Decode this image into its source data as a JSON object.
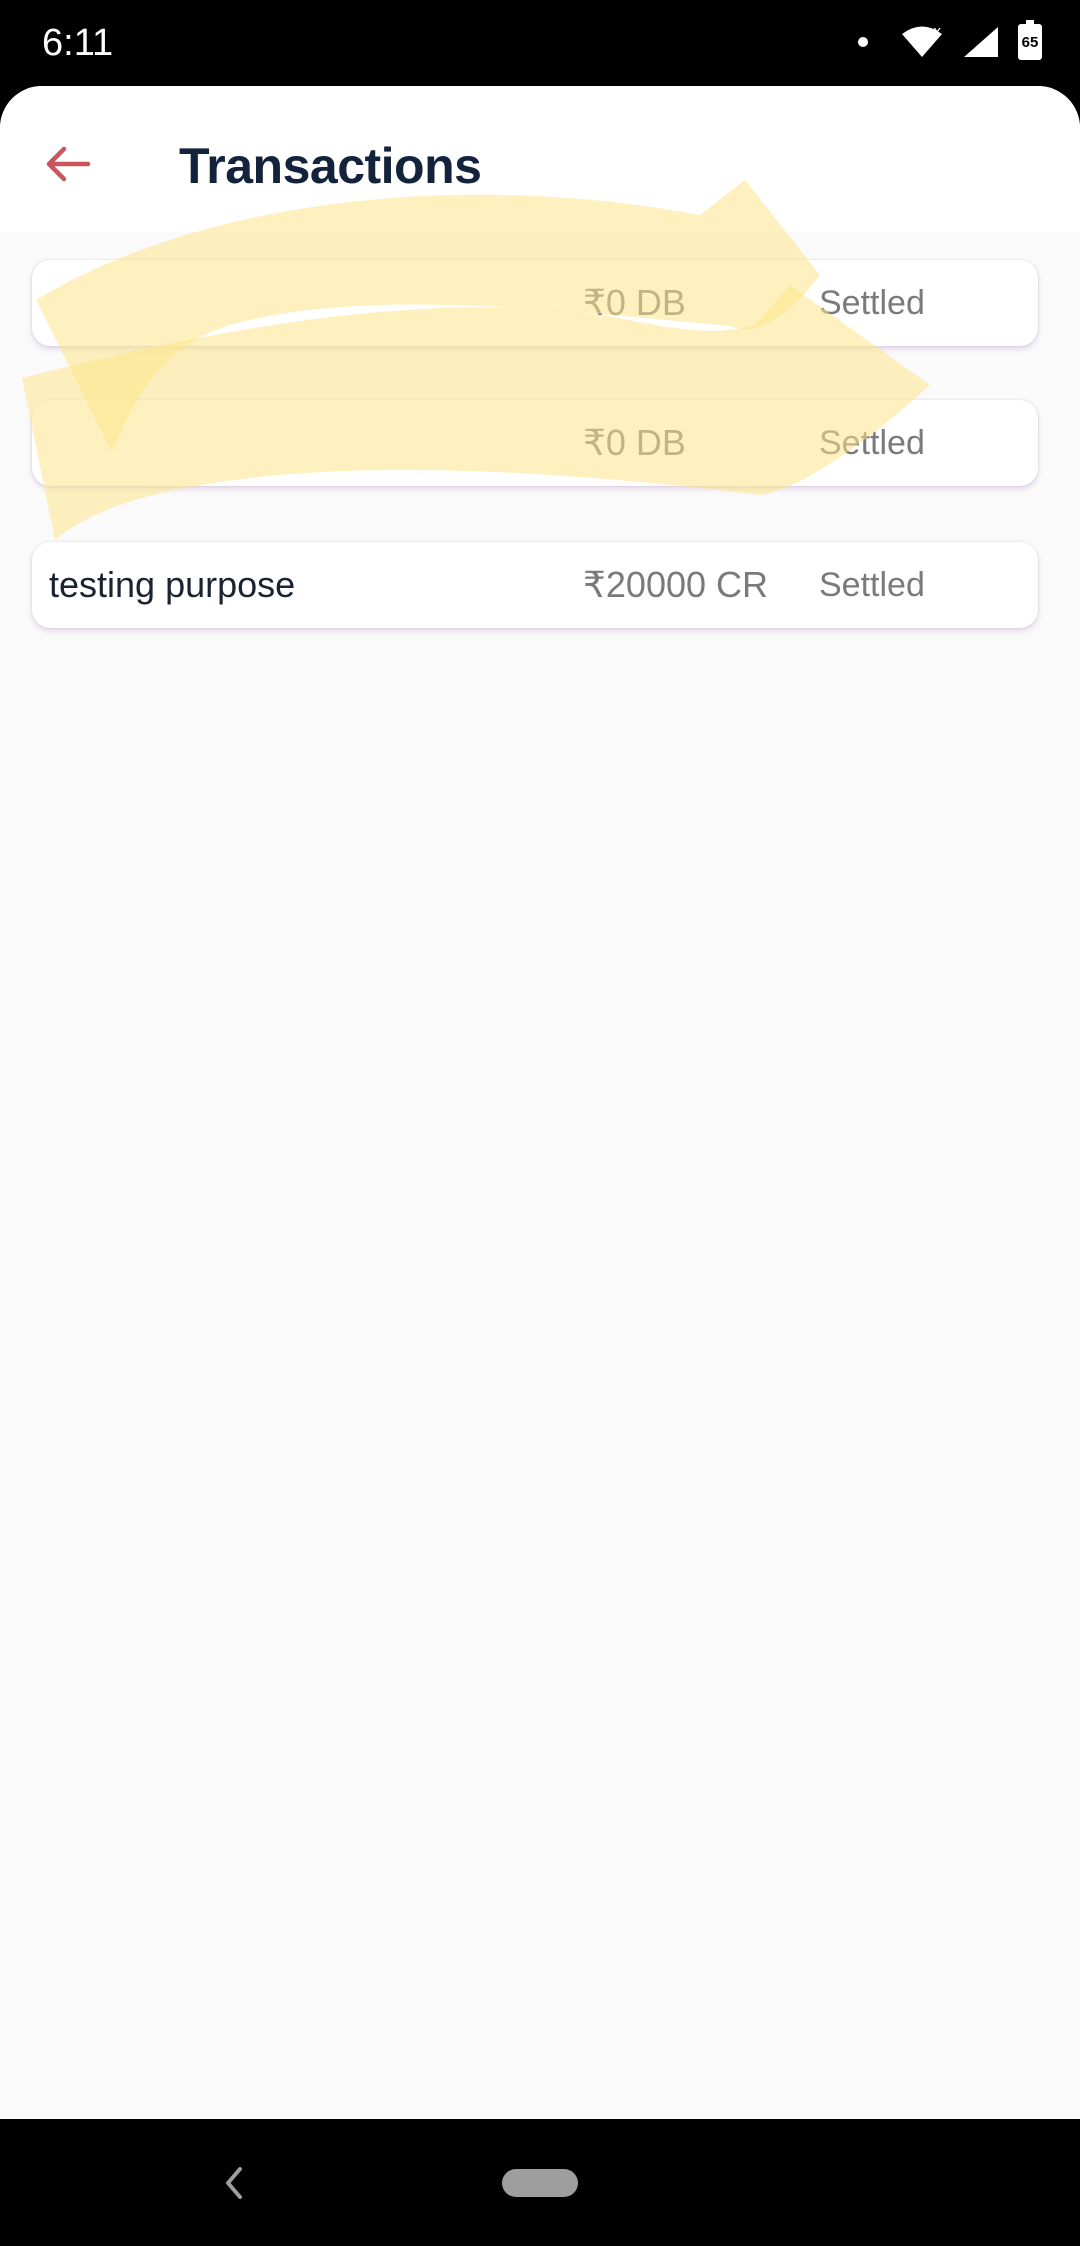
{
  "status_bar": {
    "time": "6:11",
    "battery_level": "65"
  },
  "header": {
    "title": "Transactions"
  },
  "transactions": [
    {
      "description": "",
      "amount": "₹0 DB",
      "status": "Settled"
    },
    {
      "description": "",
      "amount": "₹0 DB",
      "status": "Settled"
    },
    {
      "description": "testing purpose",
      "amount": "₹20000 CR",
      "status": "Settled"
    }
  ],
  "icons": {
    "back": "arrow-left-icon",
    "wifi": "wifi-icon",
    "signal": "cell-signal-icon",
    "battery": "battery-icon",
    "nav_back": "chevron-left-icon",
    "nav_home": "home-pill-icon"
  },
  "colors": {
    "accent": "#c9555f",
    "title": "#14233c",
    "highlight": "#fde68a"
  }
}
